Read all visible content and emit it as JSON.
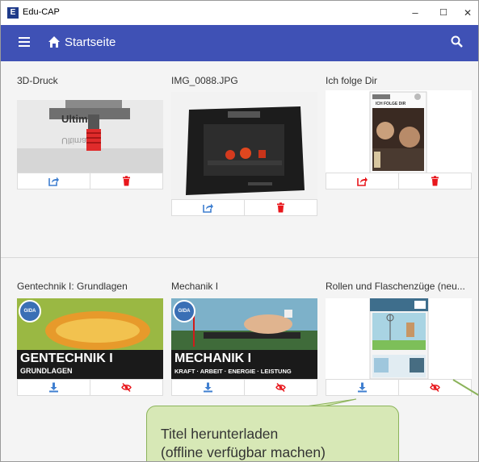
{
  "window": {
    "app_icon_letter": "E",
    "title": "Edu-CAP",
    "controls": {
      "minimize": "–",
      "maximize": "☐",
      "close": "✕"
    }
  },
  "appbar": {
    "title": "Startseite"
  },
  "cards": [
    {
      "title": "3D-Druck",
      "thumbnail": "3d-printer-nozzle-photo",
      "actions": [
        "share-icon",
        "delete-icon"
      ]
    },
    {
      "title": "IMG_0088.JPG",
      "thumbnail": "3d-printer-photo",
      "actions": [
        "share-icon",
        "delete-icon"
      ]
    },
    {
      "title": "Ich folge Dir",
      "thumbnail": "dvd-cover-ich-folge-dir",
      "cover_heading": "ICH FOLGE DIR",
      "actions": [
        "share-icon",
        "delete-icon"
      ]
    },
    {
      "title": "Gentechnik I: Grundlagen",
      "thumbnail": "gentechnik-cover",
      "banner_title": "GENTECHNIK I",
      "banner_subtitle": "GRUNDLAGEN",
      "logo_text": "GIDA",
      "actions": [
        "download-icon",
        "hide-icon"
      ]
    },
    {
      "title": "Mechanik I",
      "thumbnail": "mechanik-cover",
      "banner_title": "MECHANIK I",
      "banner_subtitle": "KRAFT · ARBEIT · ENERGIE · LEISTUNG",
      "logo_text": "GIDA",
      "actions": [
        "download-icon",
        "hide-icon"
      ]
    },
    {
      "title": "Rollen und Flaschenzüge (neu...",
      "thumbnail": "rollen-cover",
      "actions": [
        "download-icon",
        "hide-icon"
      ]
    }
  ],
  "callout": {
    "line1": "Titel herunterladen",
    "line2": "(offline verfügbar machen)"
  },
  "colors": {
    "appbar": "#3f51b5",
    "action_blue": "#3f7fd0",
    "action_red": "#e8161b",
    "callout_bg": "#d7e8b6"
  }
}
